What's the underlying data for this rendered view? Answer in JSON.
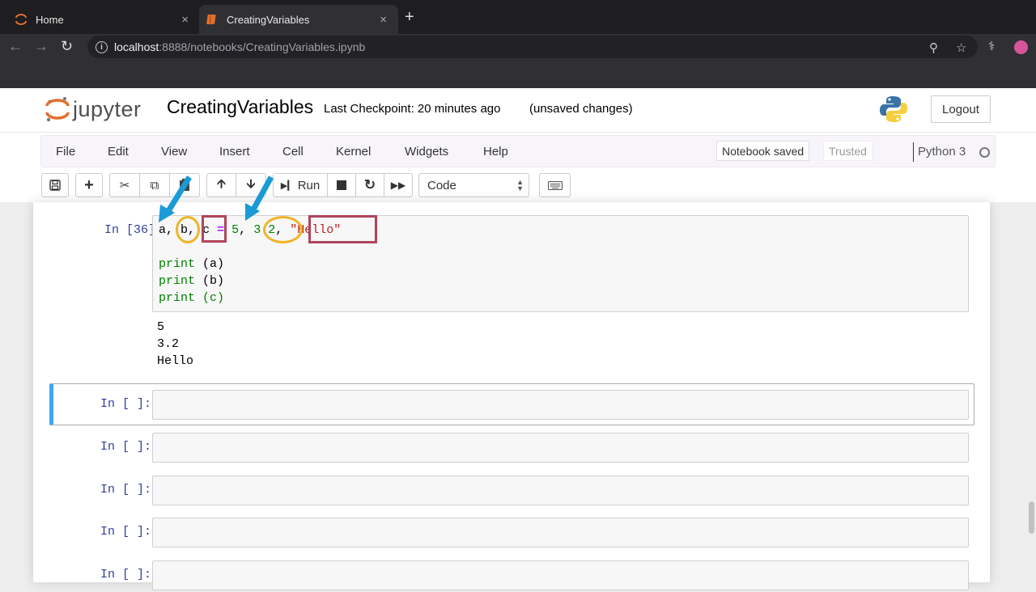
{
  "browser": {
    "tabs": [
      {
        "title": "Home",
        "icon": "jupyter-favicon",
        "active": false
      },
      {
        "title": "CreatingVariables",
        "icon": "notebook-favicon",
        "active": true
      }
    ],
    "new_tab": "+",
    "close_glyph": "×",
    "url_host": "localhost",
    "url_rest": ":8888/notebooks/CreatingVariables.ipynb",
    "info_glyph": "i"
  },
  "jupyter": {
    "logo_text": "jupyter",
    "notebook_name": "CreatingVariables",
    "checkpoint": "Last Checkpoint: 20 minutes ago",
    "unsaved": "(unsaved changes)",
    "logout": "Logout",
    "menu": [
      "File",
      "Edit",
      "View",
      "Insert",
      "Cell",
      "Kernel",
      "Widgets",
      "Help"
    ],
    "notebook_saved": "Notebook saved",
    "trusted": "Trusted",
    "kernel": "Python 3",
    "toolbar": {
      "run_label": "Run",
      "cell_type": "Code"
    }
  },
  "cells": [
    {
      "prompt": "In [36]:",
      "code": {
        "line1": {
          "a": "a,",
          "b": "b",
          "comma1": ",",
          "c": "c",
          "eq": "=",
          "five": "5",
          "comma2": ",",
          "f": "3.2",
          "comma3": ",",
          "hello": "\"Hello\""
        },
        "lines": [
          {
            "kw": "print",
            "arg": " (a)"
          },
          {
            "kw": "print",
            "arg": " (b)"
          },
          {
            "kw": "print",
            "arg": " (c)"
          }
        ]
      },
      "output": [
        "5",
        "3.2",
        "Hello"
      ]
    },
    {
      "prompt": "In [ ]:"
    },
    {
      "prompt": "In [ ]:"
    },
    {
      "prompt": "In [ ]:"
    },
    {
      "prompt": "In [ ]:"
    },
    {
      "prompt": "In [ ]:"
    }
  ],
  "colors": {
    "accent_selected": "#42a5f5",
    "prompt": "#303f9f",
    "annotation_circle": "#f0b429",
    "annotation_rect": "#b0455a",
    "annotation_arrow": "#1a9ad6"
  }
}
